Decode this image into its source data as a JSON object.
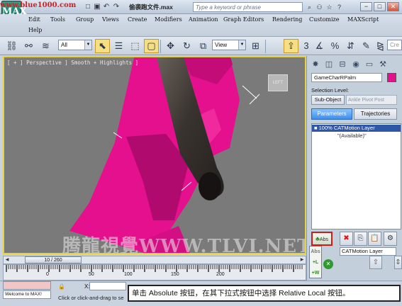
{
  "title_bar": {
    "app_logo": "MAX",
    "watermark": "www.blue1000.com",
    "file_title": "偷袭跑文件.max",
    "search_placeholder": "Type a keyword or phrase",
    "icons": [
      "new-file-icon",
      "open-folder-icon",
      "save-icon",
      "undo-icon",
      "redo-icon",
      "search-icon",
      "binoculars-icon",
      "star-icon",
      "help-icon"
    ],
    "buttons": {
      "minimize": "−",
      "maximize": "□",
      "close": "✕"
    }
  },
  "menu": {
    "items": [
      "Edit",
      "Tools",
      "Group",
      "Views",
      "Create",
      "Modifiers",
      "Animation",
      "Graph Editors",
      "Rendering",
      "Customize",
      "MAXScript",
      "Help"
    ]
  },
  "toolbar": {
    "selection_filter": "All",
    "reference_coord": "View",
    "create_label": "Cre"
  },
  "viewport": {
    "label": "[ + ] Perspective ] Smooth + Highlights ]",
    "viewcube_label": "LEFT",
    "watermark": "腾龍視覺WWW.TLVI.NET",
    "colors": {
      "background": "#7a7a7a",
      "object": "#e5108d",
      "border": "#e6d23a"
    }
  },
  "command_panel": {
    "object_name": "GameCharRPalm",
    "object_color": "#e5108d",
    "selection_level_label": "Selection Level:",
    "subobject_button": "Sub-Object",
    "subobject_value": "Ankle Pivot Post",
    "tabs": [
      "Parameters",
      "Trajectories"
    ],
    "active_tab": "Parameters",
    "layer_list": {
      "selected": "100% CATMotion Layer",
      "available": "\"(Available)\""
    },
    "abs_button": "Abs",
    "layer_name_field": "CATMotion Layer",
    "flyout_items": [
      "Abs",
      "+L",
      "+W"
    ]
  },
  "timeline": {
    "frame_display": "10 / 260",
    "tick_labels": [
      "0",
      "50",
      "100",
      "150",
      "200"
    ]
  },
  "status": {
    "maxscript_text": "Welcome to MAX!",
    "x_label": "X:",
    "prompt": "Click or click-and-drag to se"
  },
  "callout": {
    "text": "单击 Absolute 按钮，在其下拉式按钮中选择 Relative Local 按钮。"
  }
}
